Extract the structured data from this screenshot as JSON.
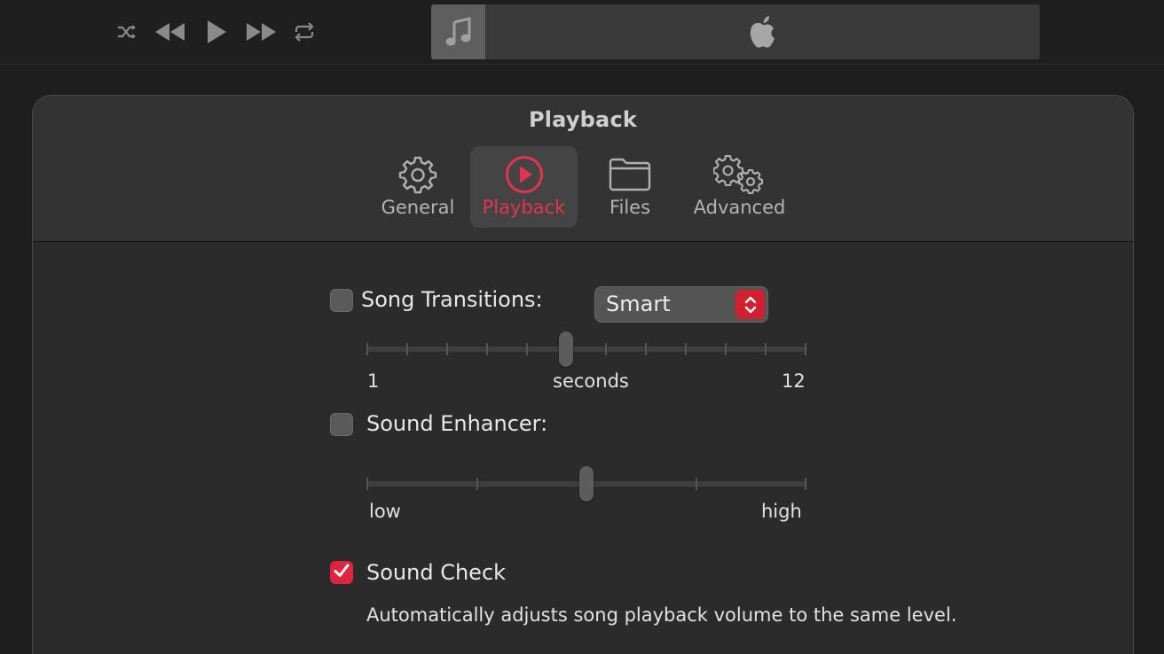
{
  "toolbar": {
    "controls": [
      "shuffle-icon",
      "rewind-icon",
      "play-icon",
      "fast-forward-icon",
      "repeat-icon"
    ],
    "lcd": {
      "art_icon": "music-note-icon",
      "logo_icon": "apple-logo-icon"
    }
  },
  "window": {
    "title": "Playback"
  },
  "tabs": [
    {
      "label": "General",
      "icon": "gear-icon",
      "active": false
    },
    {
      "label": "Playback",
      "icon": "play-circle-icon",
      "active": true
    },
    {
      "label": "Files",
      "icon": "folder-icon",
      "active": false
    },
    {
      "label": "Advanced",
      "icon": "gears-icon",
      "active": false
    }
  ],
  "song_transitions": {
    "label": "Song Transitions:",
    "checked": false,
    "mode": "Smart",
    "slider": {
      "min_label": "1",
      "mid_label": "seconds",
      "max_label": "12",
      "min": 1,
      "max": 12,
      "value": 6
    }
  },
  "sound_enhancer": {
    "label": "Sound Enhancer:",
    "checked": false,
    "slider": {
      "min_label": "low",
      "max_label": "high",
      "level": 0.5
    }
  },
  "sound_check": {
    "label": "Sound Check",
    "checked": true,
    "description": "Automatically adjusts song playback volume to the same level."
  },
  "colors": {
    "accent": "#e5334d",
    "checkbox_checked": "#e0233e",
    "popup_arrows": "#d3202f"
  }
}
